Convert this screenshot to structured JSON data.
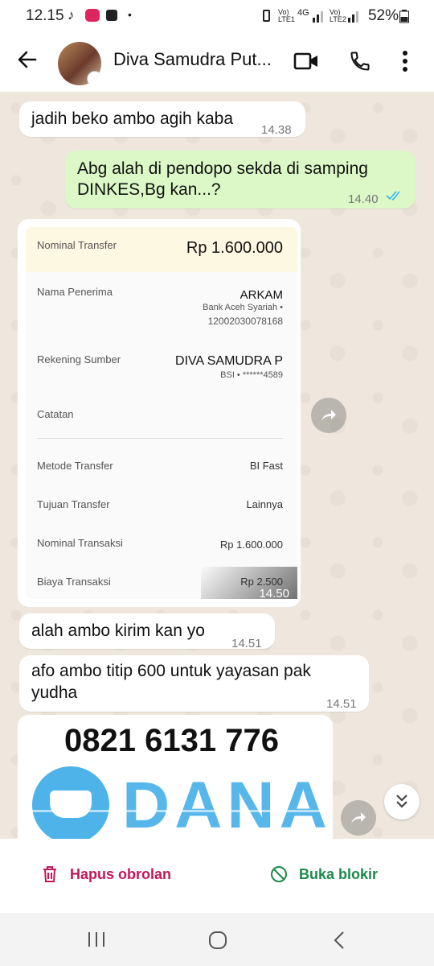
{
  "status_bar": {
    "time": "12.15",
    "sim1": "Vo) LTE1",
    "network": "4G",
    "sim2": "Vo) LTE2",
    "battery": "52%"
  },
  "header": {
    "contact_name": "Diva Samudra Put..."
  },
  "messages": [
    {
      "direction": "in",
      "text": "jadih beko ambo agih kaba",
      "time": "14.38"
    },
    {
      "direction": "out",
      "text_line1": "Abg alah di pendopo sekda di samping",
      "text_line2": "DINKES,Bg kan...?",
      "time": "14.40"
    },
    {
      "direction": "in",
      "type": "image",
      "time": "14.50"
    },
    {
      "direction": "in",
      "text": "alah ambo kirim kan yo",
      "time": "14.51"
    },
    {
      "direction": "in",
      "text_line1": "afo ambo titip 600 untuk yayasan pak",
      "text_line2": "yudha",
      "time": "14.51"
    },
    {
      "direction": "in",
      "type": "image"
    }
  ],
  "receipt": {
    "nominal_label": "Nominal Transfer",
    "nominal_value": "Rp 1.600.000",
    "recipient_label": "Nama Penerima",
    "recipient_name": "ARKAM",
    "recipient_bank": "Bank Aceh Syariah •",
    "recipient_account": "12002030078168",
    "source_label": "Rekening Sumber",
    "source_name": "DIVA SAMUDRA P",
    "source_account": "BSI • ******4589",
    "note_label": "Catatan",
    "method_label": "Metode Transfer",
    "method_value": "BI Fast",
    "purpose_label": "Tujuan Transfer",
    "purpose_value": "Lainnya",
    "txn_label": "Nominal Transaksi",
    "txn_value": "Rp 1.600.000",
    "fee_label": "Biaya Transaksi",
    "fee_value": "Rp 2.500"
  },
  "dana_image": {
    "phone": "0821 6131 776",
    "brand": "DANA"
  },
  "bottom_actions": {
    "delete_label": "Hapus obrolan",
    "unblock_label": "Buka blokir"
  },
  "colors": {
    "delete": "#c2185b",
    "unblock": "#1b8a4b",
    "read_ticks": "#34b7f1",
    "dana_blue": "#2ea6e6"
  }
}
